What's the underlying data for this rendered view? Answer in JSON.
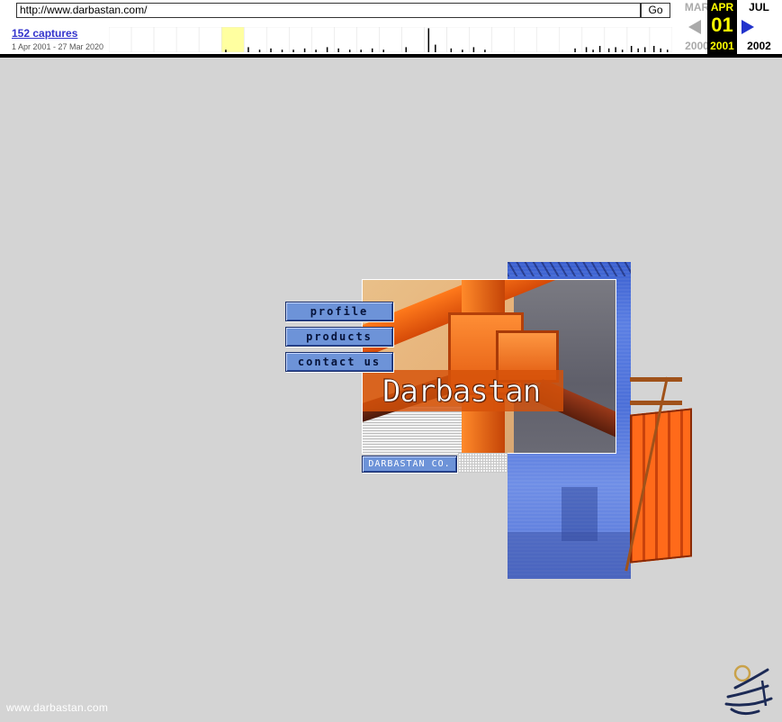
{
  "wayback": {
    "url": "http://www.darbastan.com/",
    "go_label": "Go",
    "captures_label": "152 captures",
    "date_range": "1 Apr 2001 - 27 Mar 2020",
    "prev": {
      "month": "MAR",
      "year": "2000"
    },
    "current": {
      "month": "APR",
      "day": "01",
      "year": "2001"
    },
    "next": {
      "month": "JUL",
      "year": "2002"
    },
    "icons": {
      "prev": "left-arrow-icon",
      "next": "right-arrow-icon"
    }
  },
  "nav": {
    "profile": "profile",
    "products": "products",
    "contact": "contact us"
  },
  "brand": {
    "logo_text": "Darbastan",
    "company_label": "DARBASTAN CO."
  },
  "footer": {
    "url_text": "www.darbastan.com"
  },
  "colors": {
    "background": "#d4d4d4",
    "nav_button": "#6d93d8",
    "orange": "#ff6a1a",
    "highlight_year": "#ffff00"
  }
}
